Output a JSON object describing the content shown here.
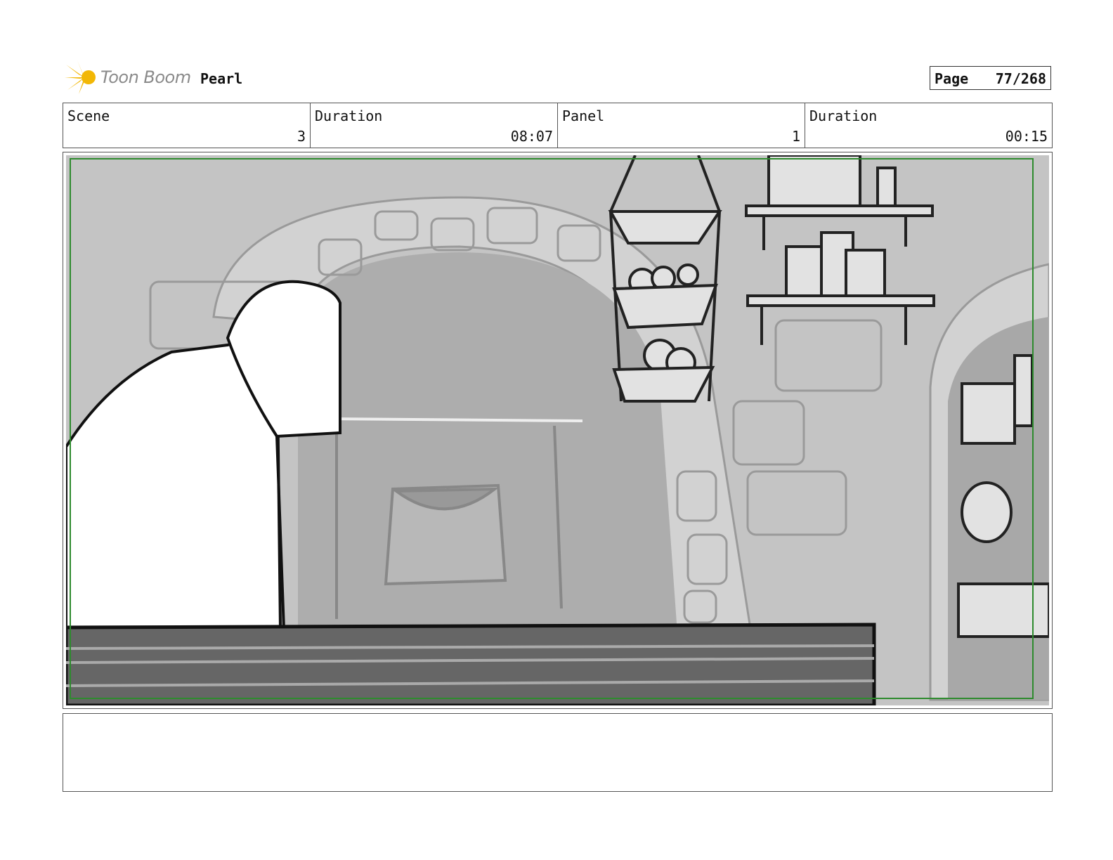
{
  "header": {
    "logo_text": "Toon Boom",
    "project_title": "Pearl",
    "page_label": "Page",
    "page_number": "77/268"
  },
  "info": {
    "scene_label": "Scene",
    "scene_value": "3",
    "scene_duration_label": "Duration",
    "scene_duration_value": "08:07",
    "panel_label": "Panel",
    "panel_value": "1",
    "panel_duration_label": "Duration",
    "panel_duration_value": "00:15"
  },
  "caption": {
    "text": ""
  },
  "colors": {
    "frame_green": "#2e8b2e",
    "logo_yellow": "#f2b705"
  }
}
